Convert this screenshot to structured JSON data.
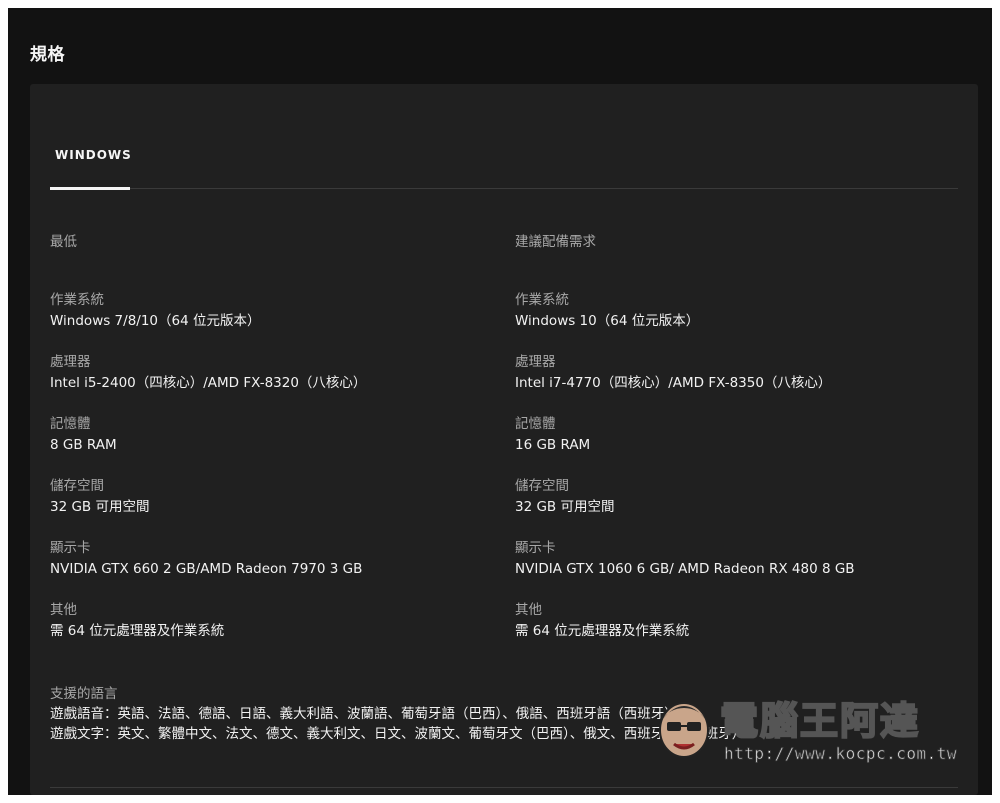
{
  "page": {
    "title": "規格"
  },
  "tabs": [
    {
      "label": "WINDOWS",
      "active": true
    }
  ],
  "minimum": {
    "heading": "最低",
    "specs": [
      {
        "label": "作業系統",
        "value": "Windows 7/8/10（64 位元版本）"
      },
      {
        "label": "處理器",
        "value": "Intel i5-2400（四核心）/AMD FX-8320（八核心）"
      },
      {
        "label": "記憶體",
        "value": "8 GB RAM"
      },
      {
        "label": "儲存空間",
        "value": "32 GB 可用空間"
      },
      {
        "label": "顯示卡",
        "value": "NVIDIA GTX 660 2 GB/AMD Radeon 7970 3 GB"
      },
      {
        "label": "其他",
        "value": "需 64 位元處理器及作業系統"
      }
    ]
  },
  "recommended": {
    "heading": "建議配備需求",
    "specs": [
      {
        "label": "作業系統",
        "value": "Windows 10（64 位元版本）"
      },
      {
        "label": "處理器",
        "value": "Intel i7-4770（四核心）/AMD FX-8350（八核心）"
      },
      {
        "label": "記憶體",
        "value": "16 GB RAM"
      },
      {
        "label": "儲存空間",
        "value": "32 GB 可用空間"
      },
      {
        "label": "顯示卡",
        "value": "NVIDIA GTX 1060 6 GB/ AMD Radeon RX 480 8 GB"
      },
      {
        "label": "其他",
        "value": "需 64 位元處理器及作業系統"
      }
    ]
  },
  "languages": {
    "label": "支援的語言",
    "audio": "遊戲語音：英語、法語、德語、日語、義大利語、波蘭語、葡萄牙語（巴西）、俄語、西班牙語（西班牙）",
    "text": "遊戲文字：英文、繁體中文、法文、德文、義大利文、日文、波蘭文、葡萄牙文（巴西）、俄文、西班牙文（西班牙）"
  },
  "watermark": {
    "title": "電腦王阿達",
    "url": "http://www.kocpc.com.tw"
  },
  "colors": {
    "background": "#121212",
    "card": "#202020",
    "label": "#a8a8a8",
    "value": "#f2f2f2"
  }
}
